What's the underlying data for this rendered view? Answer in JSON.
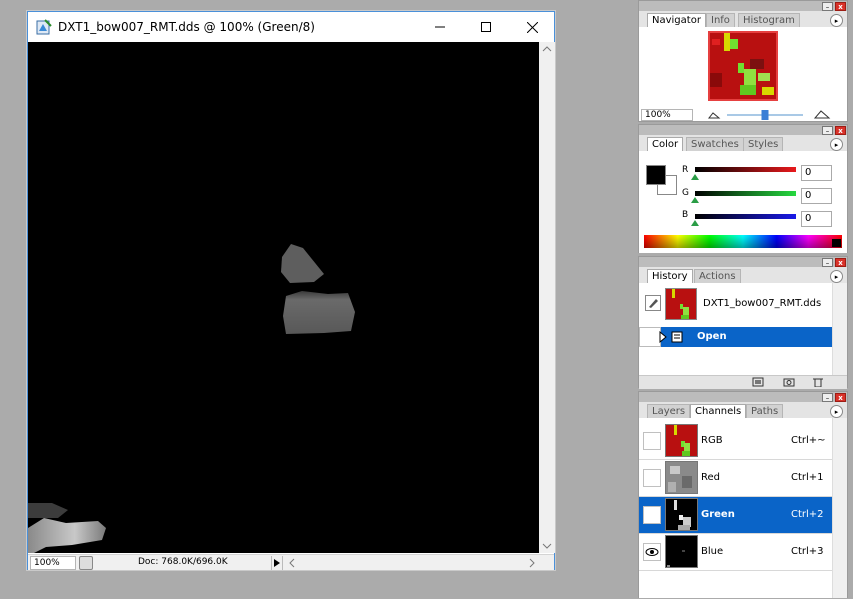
{
  "document": {
    "title": "DXT1_bow007_RMT.dds @ 100% (Green/8)",
    "zoom": "100%",
    "doc_info": "Doc: 768.0K/696.0K"
  },
  "navigator": {
    "tabs": [
      "Navigator",
      "Info",
      "Histogram"
    ],
    "active_tab": "Navigator",
    "zoom": "100%",
    "zoom_slider_level": 0.5
  },
  "color": {
    "tabs": [
      "Color",
      "Swatches",
      "Styles"
    ],
    "active_tab": "Color",
    "channels": [
      {
        "label": "R",
        "value": "0",
        "gradient_end": "#e8191c"
      },
      {
        "label": "G",
        "value": "0",
        "gradient_end": "#26d940"
      },
      {
        "label": "B",
        "value": "0",
        "gradient_end": "#1a1ae8"
      }
    ],
    "foreground": "#000000",
    "background": "#ffffff"
  },
  "history": {
    "tabs": [
      "History",
      "Actions"
    ],
    "active_tab": "History",
    "snapshot_name": "DXT1_bow007_RMT.dds",
    "steps": [
      "Open"
    ]
  },
  "channels": {
    "tabs": [
      "Layers",
      "Channels",
      "Paths"
    ],
    "active_tab": "Channels",
    "rows": [
      {
        "name": "RGB",
        "shortcut": "Ctrl+~",
        "selected": false,
        "visible": false
      },
      {
        "name": "Red",
        "shortcut": "Ctrl+1",
        "selected": false,
        "visible": false
      },
      {
        "name": "Green",
        "shortcut": "Ctrl+2",
        "selected": true,
        "visible": false
      },
      {
        "name": "Blue",
        "shortcut": "Ctrl+3",
        "selected": false,
        "visible": true
      }
    ]
  },
  "colors": {
    "accent": "#0a64c8",
    "canvas": "#000000",
    "workspace": "#ababab"
  }
}
